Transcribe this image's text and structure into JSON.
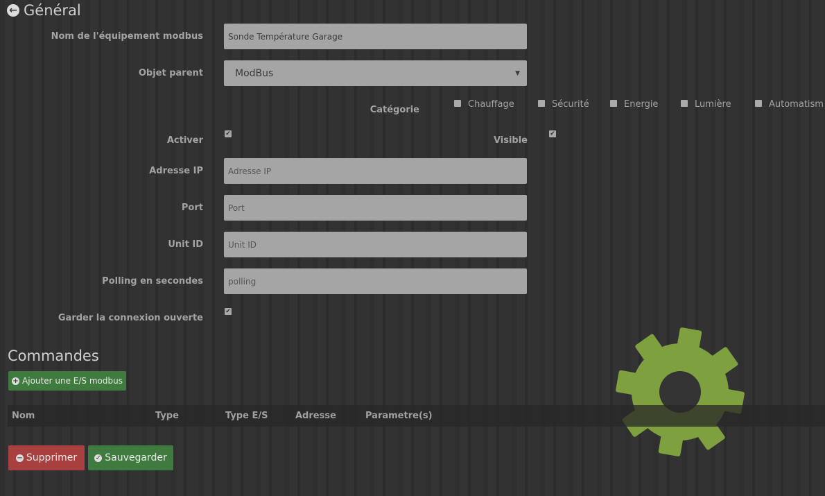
{
  "header": {
    "title": "Général",
    "back_icon": "arrow-circle-left-icon"
  },
  "form": {
    "name_label": "Nom de l'équipement modbus",
    "name_value": "Sonde Température Garage",
    "parent_label": "Objet parent",
    "parent_value": "ModBus",
    "category_label": "Catégorie",
    "categories": [
      {
        "label": "Chauffage",
        "checked": false
      },
      {
        "label": "Sécurité",
        "checked": false
      },
      {
        "label": "Energie",
        "checked": false
      },
      {
        "label": "Lumière",
        "checked": false
      },
      {
        "label": "Automatism",
        "checked": false
      }
    ],
    "activate_label": "Activer",
    "activate_checked": true,
    "visible_label": "Visible",
    "visible_checked": true,
    "ip_label": "Adresse IP",
    "ip_placeholder": "Adresse IP",
    "port_label": "Port",
    "port_placeholder": "Port",
    "unit_label": "Unit ID",
    "unit_placeholder": "Unit ID",
    "polling_label": "Polling en secondes",
    "polling_placeholder": "polling",
    "keep_label": "Garder la connexion ouverte",
    "keep_checked": true
  },
  "commands": {
    "title": "Commandes",
    "add_label": "Ajouter une E/S modbus",
    "columns": [
      "Nom",
      "Type",
      "Type E/S",
      "Adresse",
      "Parametre(s)"
    ]
  },
  "actions": {
    "delete_label": "Supprimer",
    "save_label": "Sauvegarder"
  },
  "colors": {
    "green": "#3f7a3f",
    "red": "#a84040",
    "gear": "#7ea03e"
  }
}
